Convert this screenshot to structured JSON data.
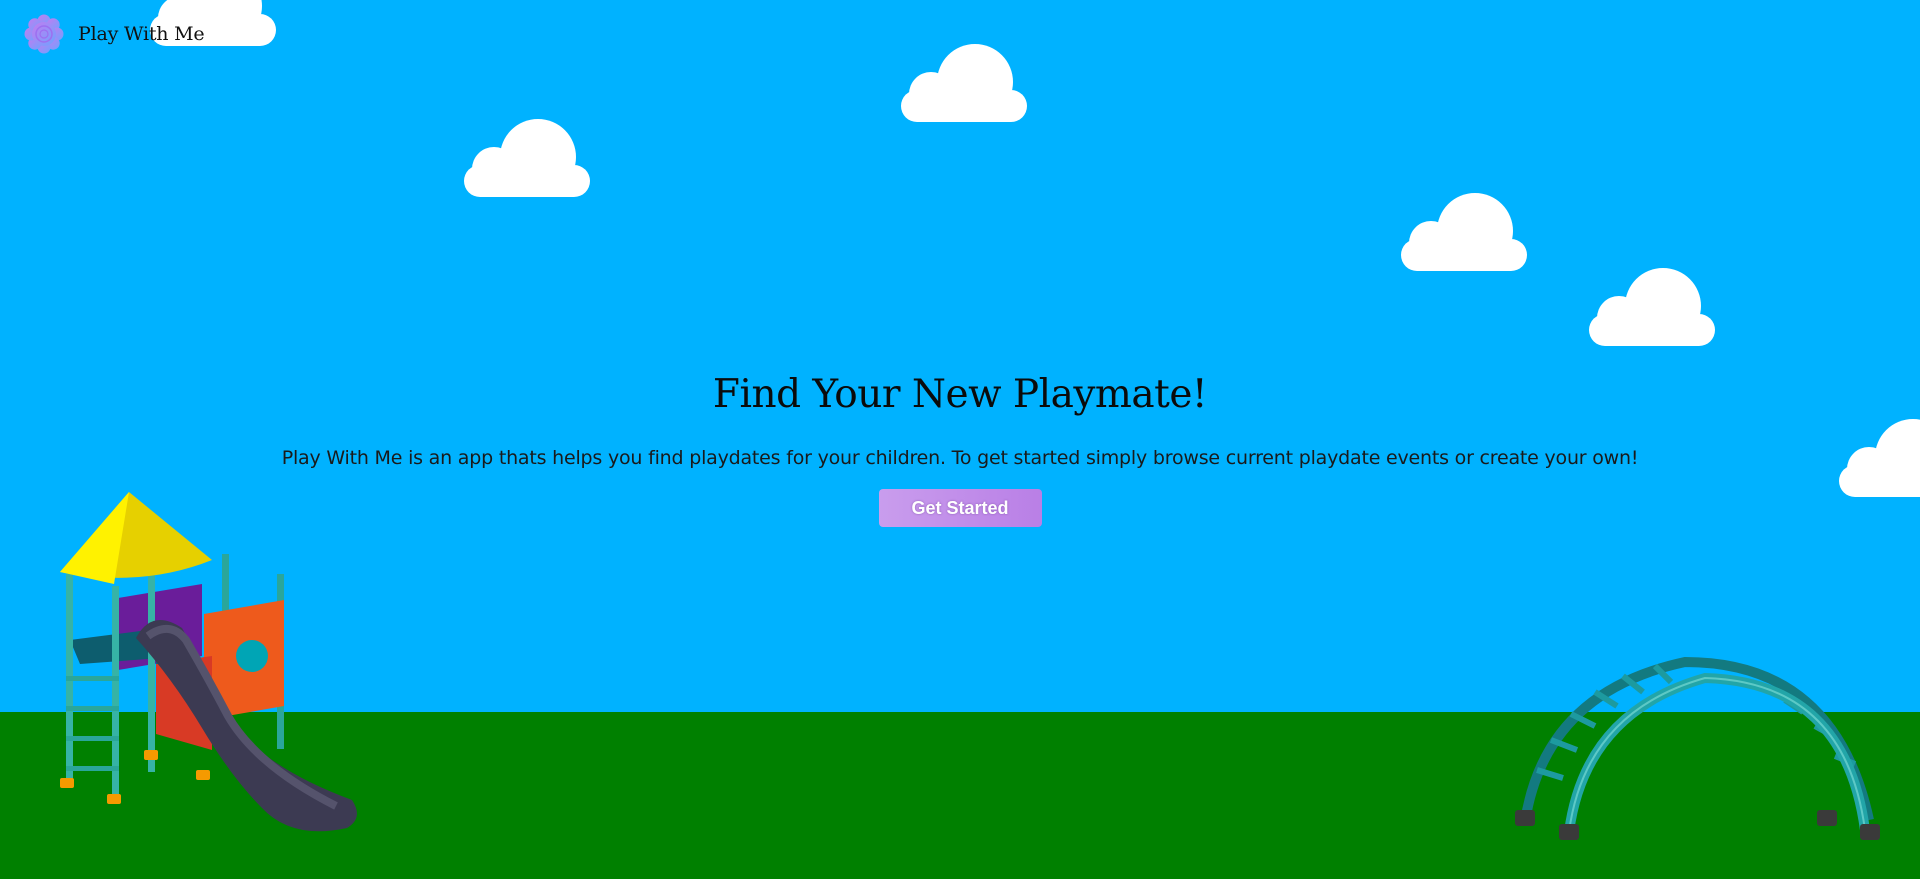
{
  "app": {
    "name": "Play With Me",
    "logo_icon": "flower-icon"
  },
  "hero": {
    "title": "Find Your New Playmate!",
    "description": "Play With Me is an app thats helps you find playdates for your children. To get started simply browse current playdate events or create your own!",
    "cta_label": "Get Started"
  },
  "colors": {
    "sky": "#00b2ff",
    "grass": "#008000",
    "cta_gradient_start": "#c99ded",
    "cta_gradient_end": "#b97fe6"
  },
  "scenery": {
    "clouds": "cloud-icon",
    "left_illustration": "playground-slide-illustration",
    "right_illustration": "climbing-dome-illustration"
  }
}
